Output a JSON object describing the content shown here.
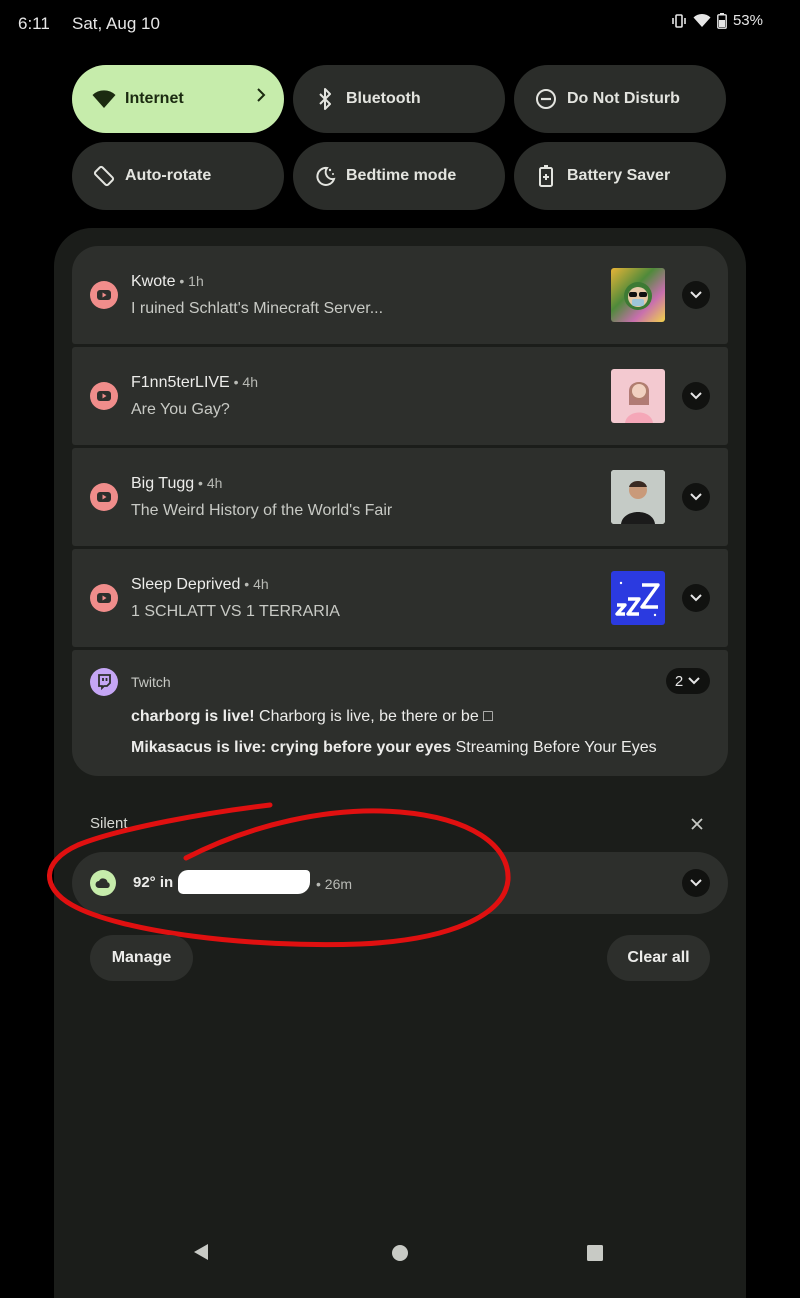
{
  "status_bar": {
    "time": "6:11",
    "date": "Sat, Aug 10",
    "battery": "53%",
    "icons": [
      "vibrate-icon",
      "wifi-icon",
      "battery-icon"
    ]
  },
  "quick_settings": [
    {
      "label": "Internet",
      "icon": "wifi-icon",
      "active": true
    },
    {
      "label": "Bluetooth",
      "icon": "bluetooth-icon",
      "active": false
    },
    {
      "label": "Do Not Disturb",
      "icon": "do-not-disturb-icon",
      "active": false
    },
    {
      "label": "Auto-rotate",
      "icon": "auto-rotate-icon",
      "active": false
    },
    {
      "label": "Bedtime mode",
      "icon": "bedtime-icon",
      "active": false
    },
    {
      "label": "Battery Saver",
      "icon": "battery-saver-icon",
      "active": false
    }
  ],
  "notifications": [
    {
      "app": "YouTube",
      "channel": "Kwote",
      "time": "1h",
      "text": "I ruined Schlatt's Minecraft Server..."
    },
    {
      "app": "YouTube",
      "channel": "F1nn5terLIVE",
      "time": "4h",
      "text": "Are You Gay?"
    },
    {
      "app": "YouTube",
      "channel": "Big Tugg",
      "time": "4h",
      "text": "The Weird History of the World's Fair"
    },
    {
      "app": "YouTube",
      "channel": "Sleep Deprived",
      "time": "4h",
      "text": "1 SCHLATT VS 1 TERRARIA"
    }
  ],
  "twitch": {
    "app": "Twitch",
    "count": "2",
    "lines": [
      {
        "bold": "charborg is live!",
        "text": "Charborg is live, be there or be □"
      },
      {
        "bold": "Mikasacus is live: crying before your eyes",
        "text": "Streaming Before Your Eyes"
      }
    ]
  },
  "silent": {
    "label": "Silent",
    "weather_text": "92° in",
    "weather_time": "26m"
  },
  "actions": {
    "manage": "Manage",
    "clear_all": "Clear all"
  },
  "colors": {
    "accent_green": "#c6ecab",
    "youtube_icon": "#f08d8b",
    "twitch_icon": "#c5a6f5",
    "annotation_red": "#e01010"
  }
}
